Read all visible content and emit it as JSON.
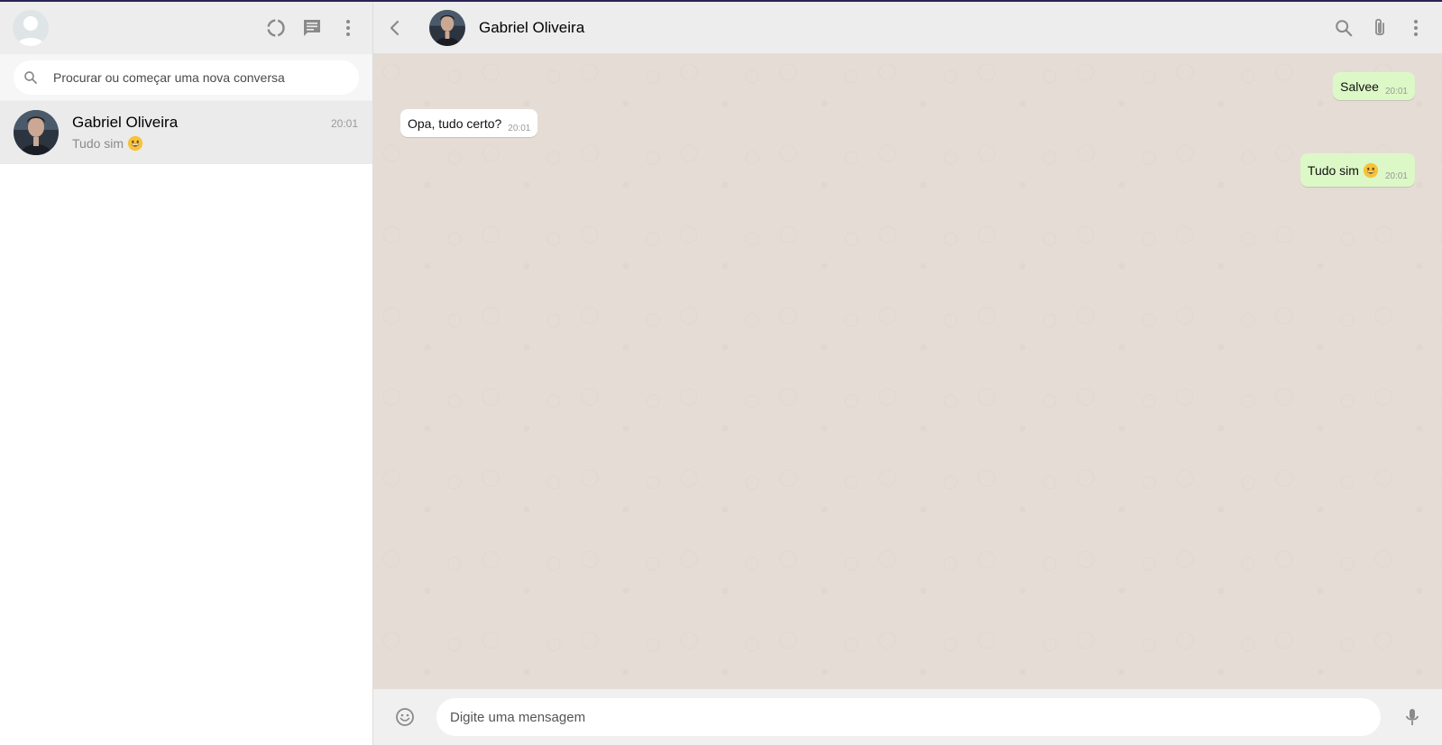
{
  "sidebar": {
    "search": {
      "placeholder": "Procurar ou começar uma nova conversa"
    },
    "chats": [
      {
        "name": "Gabriel Oliveira",
        "time": "20:01",
        "preview": "Tudo sim",
        "preview_emoji": "grinning-face"
      }
    ],
    "icons": [
      "status-icon",
      "new-chat-icon",
      "menu-icon"
    ]
  },
  "chat": {
    "contact_name": "Gabriel Oliveira",
    "messages": [
      {
        "direction": "out",
        "text": "Salvee",
        "time": "20:01"
      },
      {
        "direction": "in",
        "text": "Opa, tudo certo?",
        "time": "20:01"
      },
      {
        "direction": "out",
        "text": "Tudo sim",
        "emoji": "grinning-face",
        "time": "20:01"
      }
    ],
    "composer": {
      "placeholder": "Digite uma mensagem"
    }
  },
  "colors": {
    "header_bg": "#ededed",
    "chat_bg": "#e5ddd5",
    "outgoing_bubble": "#dcf8c6",
    "incoming_bubble": "#ffffff",
    "selected_chat_bg": "#ebebeb"
  }
}
